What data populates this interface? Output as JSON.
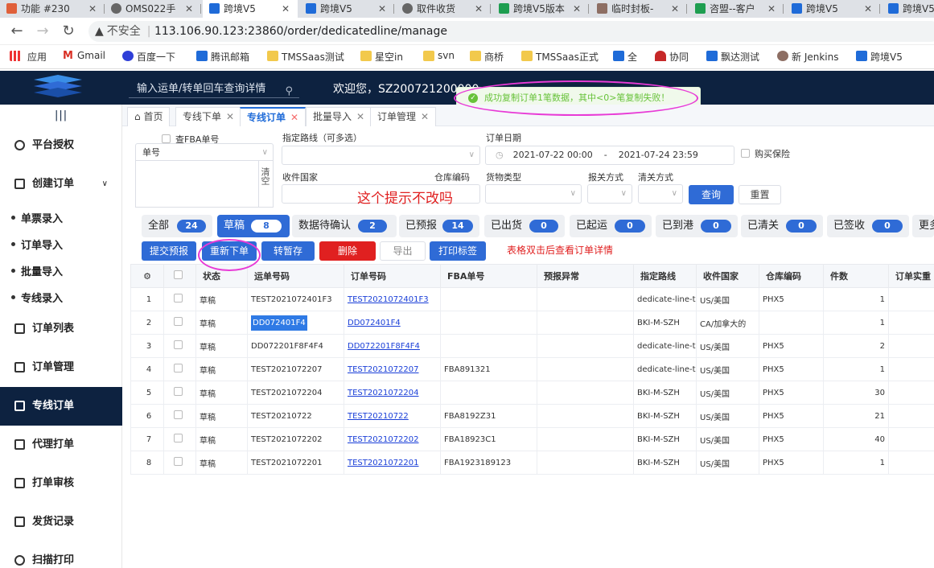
{
  "browser": {
    "tabs": [
      {
        "title": "功能 #230"
      },
      {
        "title": "OMS022手"
      },
      {
        "title": "跨境V5"
      },
      {
        "title": "跨境V5"
      },
      {
        "title": "取件收货"
      },
      {
        "title": "跨境V5版本"
      },
      {
        "title": "临时封板-"
      },
      {
        "title": "咨盟--客户"
      },
      {
        "title": "跨境V5"
      },
      {
        "title": "跨境V5"
      }
    ],
    "insecure_label": "不安全",
    "url": "113.106.90.123:23860/order/dedicatedline/manage",
    "bookmarks": [
      "应用",
      "Gmail",
      "百度一下",
      "腾讯邮箱",
      "TMSSaas测试",
      "星空in",
      "svn",
      "商桥",
      "TMSSaas正式",
      "全",
      "协同",
      "飘达测试",
      "新 Jenkins",
      "跨境V5"
    ]
  },
  "header": {
    "search_placeholder": "输入运单/转单回车查询详情",
    "welcome": "欢迎您，SZ200721200000",
    "toast": "成功复制订单1笔数据，其中<0>笔复制失败！"
  },
  "sidebar": {
    "menu_icon": "|||",
    "items": [
      {
        "label": "平台授权"
      },
      {
        "label": "创建订单"
      },
      {
        "label": "订单列表"
      },
      {
        "label": "订单管理"
      },
      {
        "label": "专线订单"
      },
      {
        "label": "代理打单"
      },
      {
        "label": "打单审核"
      },
      {
        "label": "发货记录"
      },
      {
        "label": "扫描打印"
      }
    ],
    "subitems": [
      "单票录入",
      "订单导入",
      "批量导入",
      "专线录入"
    ]
  },
  "page_tabs": [
    {
      "label": "首页"
    },
    {
      "label": "专线下单"
    },
    {
      "label": "专线订单"
    },
    {
      "label": "批量导入"
    },
    {
      "label": "订单管理"
    }
  ],
  "filters": {
    "fba_label": "查FBA单号",
    "order_type_value": "单号",
    "clear_label": "清空",
    "route_label": "指定路线（可多选）",
    "date_label": "订单日期",
    "date_start": "2021-07-22 00:00",
    "date_sep": "-",
    "date_end": "2021-07-24 23:59",
    "insurance_label": "购买保险",
    "country_label": "收件国家",
    "warehouse_label": "仓库编码",
    "goods_label": "货物类型",
    "customs_label": "报关方式",
    "clearance_label": "清关方式",
    "query_label": "查询",
    "reset_label": "重置"
  },
  "annotations": {
    "tip1": "这个提示不改吗",
    "tip2": "表格双击后查看订单详情"
  },
  "status_tabs": [
    {
      "label": "全部",
      "count": "24"
    },
    {
      "label": "草稿",
      "count": "8"
    },
    {
      "label": "数据待确认",
      "count": "2"
    },
    {
      "label": "已预报",
      "count": "14"
    },
    {
      "label": "已出货",
      "count": "0"
    },
    {
      "label": "已起运",
      "count": "0"
    },
    {
      "label": "已到港",
      "count": "0"
    },
    {
      "label": "已清关",
      "count": "0"
    },
    {
      "label": "已签收",
      "count": "0"
    },
    {
      "label": "更多"
    }
  ],
  "actions": {
    "submit": "提交预报",
    "reorder": "重新下单",
    "stash": "转暂存",
    "delete": "删除",
    "export": "导出",
    "print": "打印标签"
  },
  "table": {
    "headers": [
      "",
      "",
      "状态",
      "运单号码",
      "订单号码",
      "FBA单号",
      "预报异常",
      "指定路线",
      "收件国家",
      "仓库编码",
      "件数",
      "订单实重"
    ],
    "rows": [
      {
        "idx": "1",
        "status": "草稿",
        "waybill": "TEST2021072401F3",
        "order": "TEST2021072401F3",
        "fba": "",
        "route": "dedicate-line-te",
        "country": "US/美国",
        "wh": "PHX5",
        "qty": "1"
      },
      {
        "idx": "2",
        "status": "草稿",
        "waybill": "DD072401F4",
        "order": "DD072401F4",
        "fba": "",
        "route": "BKI-M-SZH",
        "country": "CA/加拿大的",
        "wh": "",
        "qty": "1"
      },
      {
        "idx": "3",
        "status": "草稿",
        "waybill": "DD072201F8F4F4",
        "order": "DD072201F8F4F4",
        "fba": "",
        "route": "dedicate-line-te",
        "country": "US/美国",
        "wh": "PHX5",
        "qty": "2"
      },
      {
        "idx": "4",
        "status": "草稿",
        "waybill": "TEST2021072207",
        "order": "TEST2021072207",
        "fba": "FBA891321",
        "route": "dedicate-line-te",
        "country": "US/美国",
        "wh": "PHX5",
        "qty": "1"
      },
      {
        "idx": "5",
        "status": "草稿",
        "waybill": "TEST2021072204",
        "order": "TEST2021072204",
        "fba": "",
        "route": "BKI-M-SZH",
        "country": "US/美国",
        "wh": "PHX5",
        "qty": "30"
      },
      {
        "idx": "6",
        "status": "草稿",
        "waybill": "TEST20210722",
        "order": "TEST20210722",
        "fba": "FBA8192Z31",
        "route": "BKI-M-SZH",
        "country": "US/美国",
        "wh": "PHX5",
        "qty": "21"
      },
      {
        "idx": "7",
        "status": "草稿",
        "waybill": "TEST2021072202",
        "order": "TEST2021072202",
        "fba": "FBA18923C1",
        "route": "BKI-M-SZH",
        "country": "US/美国",
        "wh": "PHX5",
        "qty": "40"
      },
      {
        "idx": "8",
        "status": "草稿",
        "waybill": "TEST2021072201",
        "order": "TEST2021072201",
        "fba": "FBA1923189123",
        "route": "BKI-M-SZH",
        "country": "US/美国",
        "wh": "PHX5",
        "qty": "1"
      }
    ]
  }
}
